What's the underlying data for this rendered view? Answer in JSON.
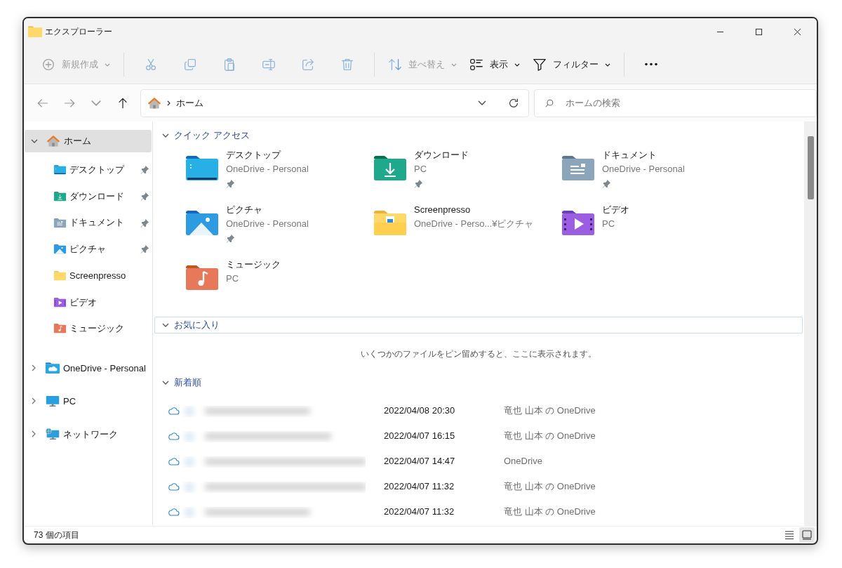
{
  "window": {
    "title": "エクスプローラー"
  },
  "toolbar": [
    {
      "kind": "new",
      "label": "新規作成",
      "disabled": true,
      "dropdown": true
    },
    {
      "kind": "separator"
    },
    {
      "kind": "cut",
      "disabled": true
    },
    {
      "kind": "copy",
      "disabled": true
    },
    {
      "kind": "paste",
      "disabled": true
    },
    {
      "kind": "rename",
      "disabled": true
    },
    {
      "kind": "share",
      "disabled": true
    },
    {
      "kind": "delete",
      "disabled": true
    },
    {
      "kind": "separator"
    },
    {
      "kind": "sort",
      "label": "並べ替え",
      "disabled": true,
      "dropdown": true
    },
    {
      "kind": "view",
      "label": "表示",
      "disabled": false,
      "dropdown": true
    },
    {
      "kind": "filter",
      "label": "フィルター",
      "disabled": false,
      "dropdown": true
    },
    {
      "kind": "separator"
    },
    {
      "kind": "more",
      "disabled": false
    }
  ],
  "navigation": [
    {
      "kind": "back",
      "disabled": true
    },
    {
      "kind": "forward",
      "disabled": true
    },
    {
      "kind": "recent",
      "disabled": true
    },
    {
      "kind": "up",
      "disabled": false
    }
  ],
  "address": {
    "path": [
      "ホーム"
    ]
  },
  "search": {
    "placeholder": "ホームの検索"
  },
  "sidebar": {
    "items": [
      {
        "kind": "home",
        "label": "ホーム",
        "selected": true,
        "expanded": true,
        "children": [
          {
            "kind": "desktop",
            "label": "デスクトップ",
            "pinned": true,
            "selected": false
          },
          {
            "kind": "downloads",
            "label": "ダウンロード",
            "pinned": true,
            "selected": false
          },
          {
            "kind": "documents",
            "label": "ドキュメント",
            "pinned": true,
            "selected": false
          },
          {
            "kind": "pictures",
            "label": "ピクチャ",
            "pinned": true,
            "selected": false
          },
          {
            "kind": "folder",
            "label": "Screenpresso",
            "pinned": false,
            "selected": false
          },
          {
            "kind": "videos",
            "label": "ビデオ",
            "pinned": false,
            "selected": false
          },
          {
            "kind": "music",
            "label": "ミュージック",
            "pinned": false,
            "selected": false
          }
        ]
      },
      {
        "kind": "onedrive",
        "label": "OneDrive - Personal",
        "selected": false,
        "expanded": false
      },
      {
        "kind": "pc",
        "label": "PC",
        "selected": false,
        "expanded": false
      },
      {
        "kind": "network",
        "label": "ネットワーク",
        "selected": false,
        "expanded": false
      }
    ]
  },
  "quick_access": {
    "title": "クイック アクセス",
    "expanded": true,
    "items": [
      {
        "kind": "desktop",
        "name": "デスクトップ",
        "location": "OneDrive - Personal",
        "pinned": true
      },
      {
        "kind": "downloads",
        "name": "ダウンロード",
        "location": "PC",
        "pinned": true
      },
      {
        "kind": "documents",
        "name": "ドキュメント",
        "location": "OneDrive - Personal",
        "pinned": true
      },
      {
        "kind": "pictures",
        "name": "ピクチャ",
        "location": "OneDrive - Personal",
        "pinned": true
      },
      {
        "kind": "screenpresso",
        "name": "Screenpresso",
        "location": "OneDrive - Perso...¥ピクチャ",
        "pinned": false
      },
      {
        "kind": "videos",
        "name": "ビデオ",
        "location": "PC",
        "pinned": false
      },
      {
        "kind": "music",
        "name": "ミュージック",
        "location": "PC",
        "pinned": false
      }
    ]
  },
  "favorites": {
    "title": "お気に入り",
    "expanded": true,
    "focused": true,
    "message": "いくつかのファイルをピン留めすると、ここに表示されます。"
  },
  "recent": {
    "title": "新着順",
    "expanded": true,
    "files": [
      {
        "modified": "2022/04/08 20:30",
        "location": "竜也 山本 の OneDrive"
      },
      {
        "modified": "2022/04/07 16:15",
        "location": "竜也 山本 の OneDrive"
      },
      {
        "modified": "2022/04/07 14:47",
        "location": "OneDrive"
      },
      {
        "modified": "2022/04/07 11:32",
        "location": "竜也 山本 の OneDrive"
      },
      {
        "modified": "2022/04/07 11:32",
        "location": "竜也 山本 の OneDrive"
      }
    ]
  },
  "status_bar": {
    "item_count": "73 個の項目",
    "views": [
      {
        "kind": "details",
        "selected": false
      },
      {
        "kind": "tiles",
        "selected": true
      }
    ]
  }
}
